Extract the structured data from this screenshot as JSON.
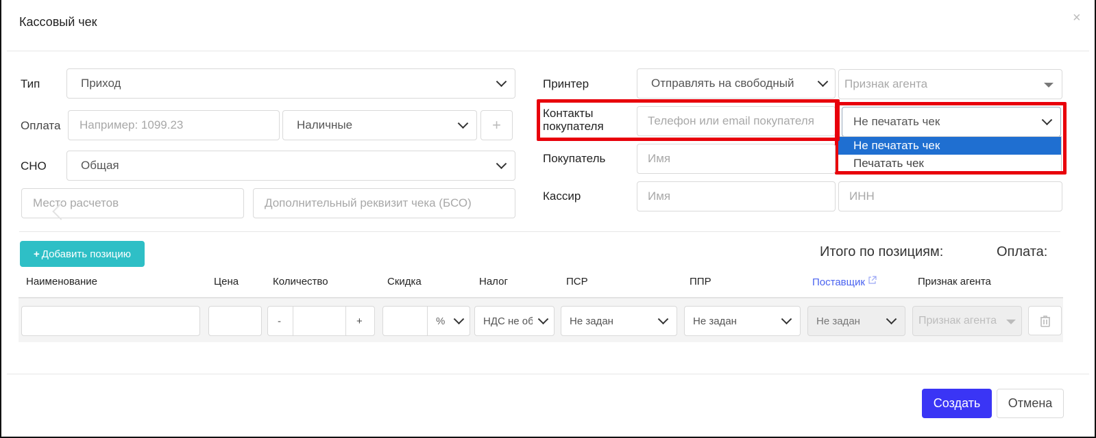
{
  "modal": {
    "title": "Кассовый чек",
    "close_icon": "×"
  },
  "left": {
    "type_label": "Тип",
    "type_value": "Приход",
    "payment_label": "Оплата",
    "payment_placeholder": "Например: 1099.23",
    "payment_method": "Наличные",
    "add_icon": "+",
    "sno_label": "СНО",
    "sno_value": "Общая",
    "place_placeholder": "Место расчетов",
    "extra_placeholder": "Дополнительный реквизит чека (БСО)"
  },
  "right": {
    "printer_label": "Принтер",
    "printer_value": "Отправлять на свободный",
    "agent_placeholder": "Признак агента",
    "contacts_label_1": "Контакты",
    "contacts_label_2": "покупателя",
    "contacts_placeholder": "Телефон или email покупателя",
    "print_select_value": "Не печатать чек",
    "print_options": [
      "Не печатать чек",
      "Печатать чек"
    ],
    "buyer_label": "Покупатель",
    "buyer_placeholder": "Имя",
    "cashier_label": "Кассир",
    "cashier_placeholder": "Имя",
    "inn_placeholder": "ИНН"
  },
  "positions": {
    "add_button": "Добавить позицию",
    "add_icon": "+",
    "total_label": "Итого по позициям:",
    "payment_label": "Оплата:",
    "headers": {
      "name": "Наименование",
      "price": "Цена",
      "qty": "Количество",
      "discount": "Скидка",
      "tax": "Налог",
      "psr": "ПСР",
      "ppr": "ППР",
      "supplier": "Поставщик",
      "agent": "Признак агента"
    },
    "row": {
      "minus": "-",
      "plus": "+",
      "percent": "%",
      "tax_value": "НДС не об",
      "psr_value": "Не задан",
      "ppr_value": "Не задан",
      "supplier_value": "Не задан",
      "agent_placeholder": "Признак агента"
    }
  },
  "footer": {
    "create": "Создать",
    "cancel": "Отмена"
  },
  "colors": {
    "accent": "#3a35f5",
    "teal": "#2ebfc6",
    "highlight": "#e8000b",
    "selected": "#1f6fd1",
    "link": "#4a63f0"
  }
}
